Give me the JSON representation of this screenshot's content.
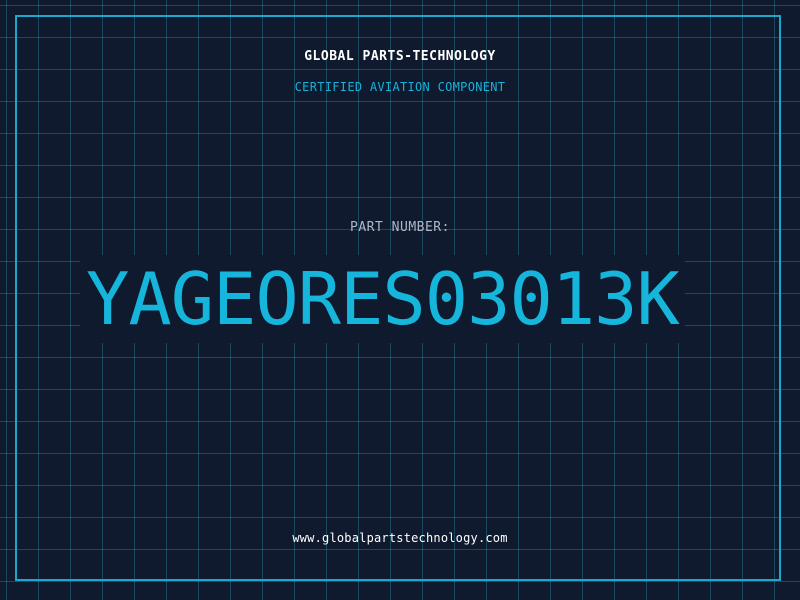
{
  "header": {
    "company": "GLOBAL PARTS-TECHNOLOGY",
    "subtitle": "CERTIFIED AVIATION COMPONENT"
  },
  "part": {
    "label": "PART NUMBER:",
    "number": "YAGEORES03013K"
  },
  "footer": {
    "url": "www.globalpartstechnology.com"
  },
  "colors": {
    "background": "#101a2e",
    "accent": "#16b6dc",
    "frame": "#1aa8cc",
    "grid": "#28828f"
  }
}
